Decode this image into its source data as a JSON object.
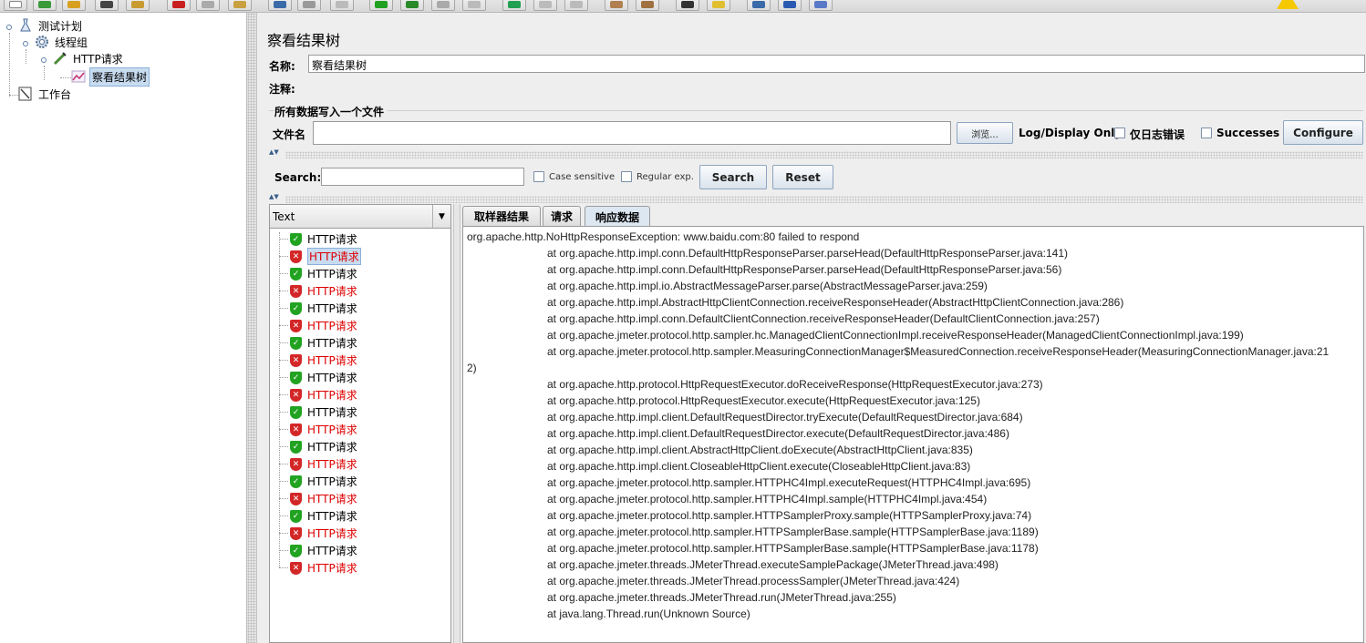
{
  "tree": {
    "test_plan": "测试计划",
    "thread_group": "线程组",
    "http_request": "HTTP请求",
    "result_tree": "察看结果树",
    "workbench": "工作台"
  },
  "panel": {
    "title": "察看结果树",
    "name_label": "名称:",
    "name_value": "察看结果树",
    "comment_label": "注释:",
    "file_group_title": "所有数据写入一个文件",
    "filename_label": "文件名",
    "filename_value": "",
    "browse_label": "浏览...",
    "log_display_label": "Log/Display Only:",
    "errors_only_label": "仅日志错误",
    "successes_label": "Successes",
    "configure_label": "Configure"
  },
  "search": {
    "label": "Search:",
    "value": "",
    "case_sensitive_label": "Case sensitive",
    "regex_label": "Regular exp.",
    "search_button": "Search",
    "reset_button": "Reset"
  },
  "results": {
    "renderer": "Text",
    "samples": [
      {
        "label": "HTTP请求",
        "status": "ok"
      },
      {
        "label": "HTTP请求",
        "status": "error",
        "selected": true
      },
      {
        "label": "HTTP请求",
        "status": "ok"
      },
      {
        "label": "HTTP请求",
        "status": "error"
      },
      {
        "label": "HTTP请求",
        "status": "ok"
      },
      {
        "label": "HTTP请求",
        "status": "error"
      },
      {
        "label": "HTTP请求",
        "status": "ok"
      },
      {
        "label": "HTTP请求",
        "status": "error"
      },
      {
        "label": "HTTP请求",
        "status": "ok"
      },
      {
        "label": "HTTP请求",
        "status": "error"
      },
      {
        "label": "HTTP请求",
        "status": "ok"
      },
      {
        "label": "HTTP请求",
        "status": "error"
      },
      {
        "label": "HTTP请求",
        "status": "ok"
      },
      {
        "label": "HTTP请求",
        "status": "error"
      },
      {
        "label": "HTTP请求",
        "status": "ok"
      },
      {
        "label": "HTTP请求",
        "status": "error"
      },
      {
        "label": "HTTP请求",
        "status": "ok"
      },
      {
        "label": "HTTP请求",
        "status": "error"
      },
      {
        "label": "HTTP请求",
        "status": "ok"
      },
      {
        "label": "HTTP请求",
        "status": "error"
      }
    ],
    "tabs": [
      "取样器结果",
      "请求",
      "响应数据"
    ],
    "active_tab": "响应数据",
    "response_lines": [
      {
        "indent": false,
        "text": "org.apache.http.NoHttpResponseException: www.baidu.com:80 failed to respond"
      },
      {
        "indent": true,
        "text": "at org.apache.http.impl.conn.DefaultHttpResponseParser.parseHead(DefaultHttpResponseParser.java:141)"
      },
      {
        "indent": true,
        "text": "at org.apache.http.impl.conn.DefaultHttpResponseParser.parseHead(DefaultHttpResponseParser.java:56)"
      },
      {
        "indent": true,
        "text": "at org.apache.http.impl.io.AbstractMessageParser.parse(AbstractMessageParser.java:259)"
      },
      {
        "indent": true,
        "text": "at org.apache.http.impl.AbstractHttpClientConnection.receiveResponseHeader(AbstractHttpClientConnection.java:286)"
      },
      {
        "indent": true,
        "text": "at org.apache.http.impl.conn.DefaultClientConnection.receiveResponseHeader(DefaultClientConnection.java:257)"
      },
      {
        "indent": true,
        "text": "at org.apache.jmeter.protocol.http.sampler.hc.ManagedClientConnectionImpl.receiveResponseHeader(ManagedClientConnectionImpl.java:199)"
      },
      {
        "indent": true,
        "text": "at org.apache.jmeter.protocol.http.sampler.MeasuringConnectionManager$MeasuredConnection.receiveResponseHeader(MeasuringConnectionManager.java:21"
      },
      {
        "indent": false,
        "text": "2)"
      },
      {
        "indent": true,
        "text": "at org.apache.http.protocol.HttpRequestExecutor.doReceiveResponse(HttpRequestExecutor.java:273)"
      },
      {
        "indent": true,
        "text": "at org.apache.http.protocol.HttpRequestExecutor.execute(HttpRequestExecutor.java:125)"
      },
      {
        "indent": true,
        "text": "at org.apache.http.impl.client.DefaultRequestDirector.tryExecute(DefaultRequestDirector.java:684)"
      },
      {
        "indent": true,
        "text": "at org.apache.http.impl.client.DefaultRequestDirector.execute(DefaultRequestDirector.java:486)"
      },
      {
        "indent": true,
        "text": "at org.apache.http.impl.client.AbstractHttpClient.doExecute(AbstractHttpClient.java:835)"
      },
      {
        "indent": true,
        "text": "at org.apache.http.impl.client.CloseableHttpClient.execute(CloseableHttpClient.java:83)"
      },
      {
        "indent": true,
        "text": "at org.apache.jmeter.protocol.http.sampler.HTTPHC4Impl.executeRequest(HTTPHC4Impl.java:695)"
      },
      {
        "indent": true,
        "text": "at org.apache.jmeter.protocol.http.sampler.HTTPHC4Impl.sample(HTTPHC4Impl.java:454)"
      },
      {
        "indent": true,
        "text": "at org.apache.jmeter.protocol.http.sampler.HTTPSamplerProxy.sample(HTTPSamplerProxy.java:74)"
      },
      {
        "indent": true,
        "text": "at org.apache.jmeter.protocol.http.sampler.HTTPSamplerBase.sample(HTTPSamplerBase.java:1189)"
      },
      {
        "indent": true,
        "text": "at org.apache.jmeter.protocol.http.sampler.HTTPSamplerBase.sample(HTTPSamplerBase.java:1178)"
      },
      {
        "indent": true,
        "text": "at org.apache.jmeter.threads.JMeterThread.executeSamplePackage(JMeterThread.java:498)"
      },
      {
        "indent": true,
        "text": "at org.apache.jmeter.threads.JMeterThread.processSampler(JMeterThread.java:424)"
      },
      {
        "indent": true,
        "text": "at org.apache.jmeter.threads.JMeterThread.run(JMeterThread.java:255)"
      },
      {
        "indent": true,
        "text": "at java.lang.Thread.run(Unknown Source)"
      }
    ]
  },
  "colors": {
    "ok": "#21a321",
    "error": "#d32727",
    "selection": "#c8dcf0"
  }
}
